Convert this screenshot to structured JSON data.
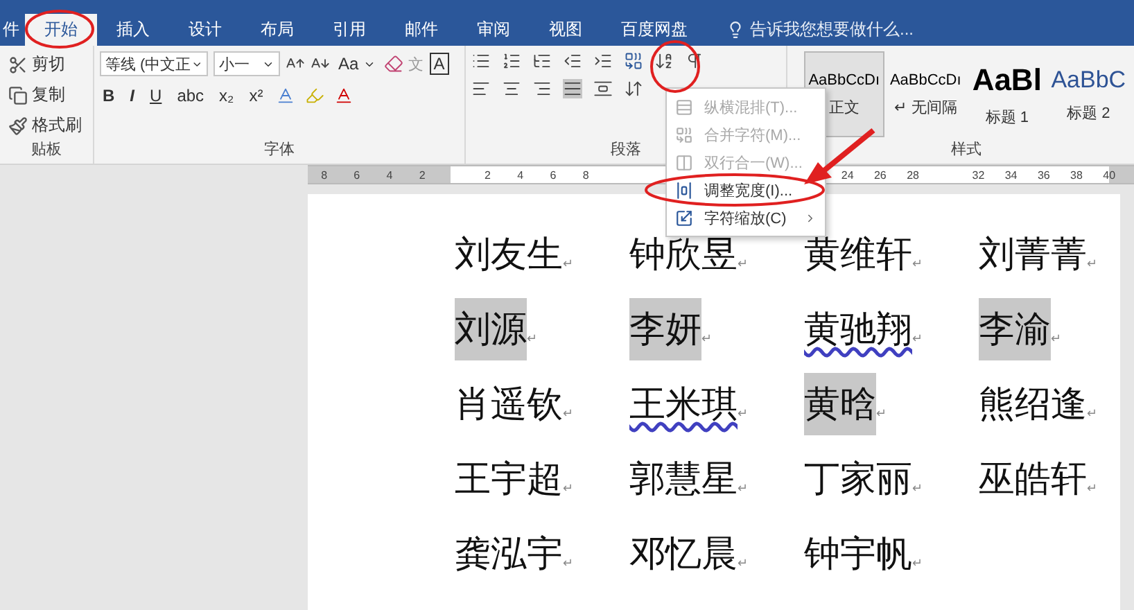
{
  "tabs": [
    {
      "label": "件",
      "selected": false
    },
    {
      "label": "开始",
      "selected": true
    },
    {
      "label": "插入",
      "selected": false
    },
    {
      "label": "设计",
      "selected": false
    },
    {
      "label": "布局",
      "selected": false
    },
    {
      "label": "引用",
      "selected": false
    },
    {
      "label": "邮件",
      "selected": false
    },
    {
      "label": "审阅",
      "selected": false
    },
    {
      "label": "视图",
      "selected": false
    },
    {
      "label": "百度网盘",
      "selected": false
    }
  ],
  "tell_me": {
    "placeholder": "告诉我您想要做什么..."
  },
  "clipboard": {
    "label": "贴板",
    "items": [
      {
        "kind": "cut",
        "label": "剪切"
      },
      {
        "kind": "copy",
        "label": "复制"
      },
      {
        "kind": "painter",
        "label": "格式刷"
      }
    ]
  },
  "font": {
    "label": "字体",
    "name": "等线 (中文正",
    "size": "小一",
    "case_button": "Aa",
    "phonetic": "文",
    "border_char": "A",
    "format_buttons": [
      "B",
      "I",
      "U",
      "abc",
      "x₂",
      "x²"
    ]
  },
  "paragraph": {
    "label": "段落"
  },
  "styles": {
    "label": "样式",
    "items": [
      {
        "kind": "body",
        "preview": "AaBbCcDı",
        "name": "正文",
        "selected": true
      },
      {
        "kind": "body",
        "preview": "AaBbCcDı",
        "name": "↵ 无间隔",
        "selected": false
      },
      {
        "kind": "heading1",
        "preview": "AaBl",
        "name": "标题 1",
        "selected": false
      },
      {
        "kind": "heading2",
        "preview": "AaBbC",
        "name": "标题 2",
        "selected": false
      }
    ]
  },
  "menu": {
    "items": [
      {
        "kind": "vertical",
        "label": "纵横混排(T)...",
        "disabled": true,
        "submenu": false
      },
      {
        "kind": "combine",
        "label": "合并字符(M)...",
        "disabled": true,
        "submenu": false
      },
      {
        "kind": "two_lines",
        "label": "双行合一(W)...",
        "disabled": true,
        "submenu": false
      },
      {
        "kind": "width",
        "label": "调整宽度(I)...",
        "disabled": false,
        "submenu": false
      },
      {
        "kind": "scale",
        "label": "字符缩放(C)",
        "disabled": false,
        "submenu": true
      }
    ]
  },
  "ruler": {
    "groups": [
      [
        "8",
        "6",
        "4",
        "2"
      ],
      [
        "2",
        "4",
        "6",
        "8"
      ],
      [
        "24",
        "26",
        "28"
      ],
      [
        "32",
        "34",
        "36",
        "38",
        "40"
      ]
    ]
  },
  "names": [
    {
      "text": "刘友生",
      "mark": "↵",
      "shaded": false,
      "misspelled": false
    },
    {
      "text": "钟欣昱",
      "mark": "↵",
      "shaded": false,
      "misspelled": false
    },
    {
      "text": "黄维轩",
      "mark": "↵",
      "shaded": false,
      "misspelled": false
    },
    {
      "text": "刘菁菁",
      "mark": "↵",
      "shaded": false,
      "misspelled": false
    },
    {
      "text": "刘源",
      "mark": "↵",
      "shaded": true,
      "misspelled": false
    },
    {
      "text": "李妍",
      "mark": "↵",
      "shaded": true,
      "misspelled": false
    },
    {
      "text": "黄驰翔",
      "mark": "↵",
      "shaded": false,
      "misspelled": true
    },
    {
      "text": "李渝",
      "mark": "↵",
      "shaded": true,
      "misspelled": false
    },
    {
      "text": "肖遥钦",
      "mark": "↵",
      "shaded": false,
      "misspelled": false
    },
    {
      "text": "王米琪",
      "mark": "↵",
      "shaded": false,
      "misspelled": true
    },
    {
      "text": "黄晗",
      "mark": "↵",
      "shaded": true,
      "misspelled": false
    },
    {
      "text": "熊绍逢",
      "mark": "↵",
      "shaded": false,
      "misspelled": false
    },
    {
      "text": "王宇超",
      "mark": "↵",
      "shaded": false,
      "misspelled": false
    },
    {
      "text": "郭慧星",
      "mark": "↵",
      "shaded": false,
      "misspelled": false
    },
    {
      "text": "丁家丽",
      "mark": "↵",
      "shaded": false,
      "misspelled": false
    },
    {
      "text": "巫皓轩",
      "mark": "↵",
      "shaded": false,
      "misspelled": false
    },
    {
      "text": "龚泓宇",
      "mark": "↵",
      "shaded": false,
      "misspelled": false
    },
    {
      "text": "邓忆晨",
      "mark": "↵",
      "shaded": false,
      "misspelled": false
    },
    {
      "text": "钟宇帆",
      "mark": "↵",
      "shaded": false,
      "misspelled": false
    }
  ]
}
